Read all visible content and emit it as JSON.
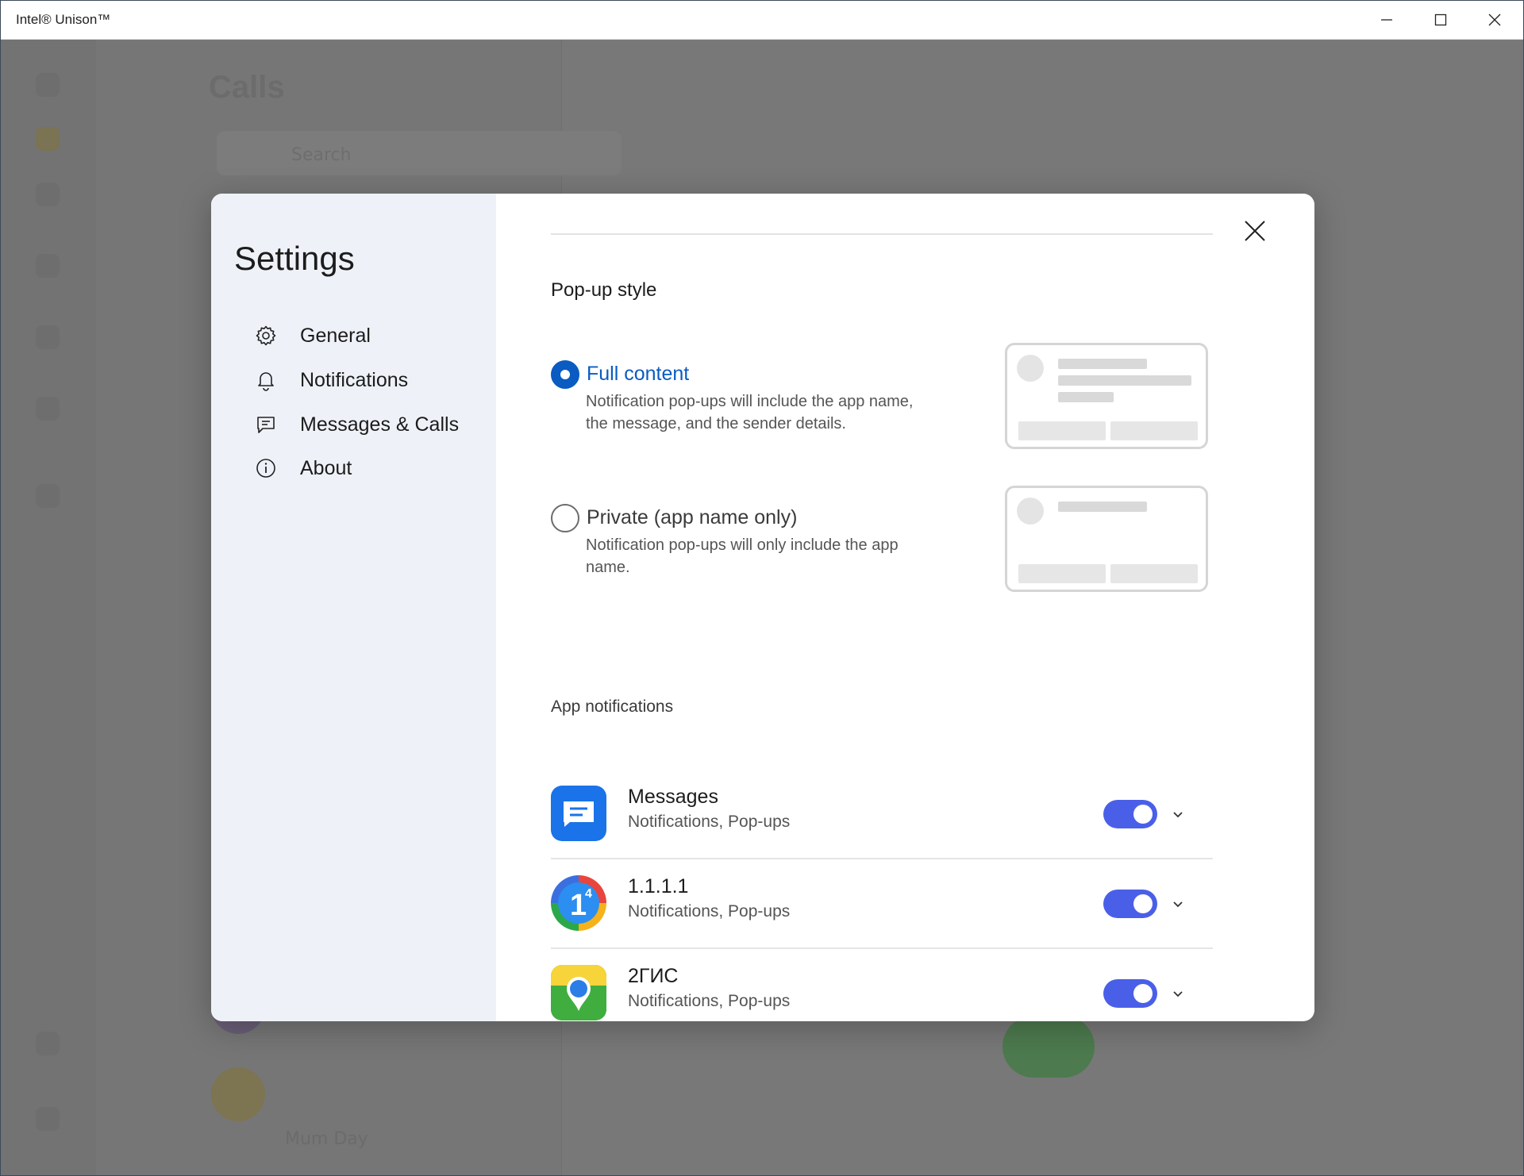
{
  "window": {
    "title": "Intel® Unison™"
  },
  "background": {
    "page_title": "Calls",
    "search_placeholder": "Search",
    "contact_name": "Mum Day"
  },
  "settings": {
    "title": "Settings",
    "nav": [
      {
        "label": "General",
        "icon": "gear-icon"
      },
      {
        "label": "Notifications",
        "icon": "bell-icon"
      },
      {
        "label": "Messages & Calls",
        "icon": "message-icon"
      },
      {
        "label": "About",
        "icon": "info-icon"
      }
    ],
    "popup_style": {
      "heading": "Pop-up style",
      "options": [
        {
          "title": "Full content",
          "desc": "Notification pop-ups will include the app name, the message, and the sender details.",
          "selected": true
        },
        {
          "title": "Private (app name only)",
          "desc": "Notification pop-ups will only include the app name.",
          "selected": false
        }
      ]
    },
    "app_notifications": {
      "heading": "App notifications",
      "apps": [
        {
          "name": "Messages",
          "sub": "Notifications, Pop-ups",
          "enabled": true
        },
        {
          "name": "1.1.1.1",
          "sub": "Notifications, Pop-ups",
          "enabled": true
        },
        {
          "name": "2ГИС",
          "sub": "Notifications, Pop-ups",
          "enabled": true
        }
      ]
    }
  },
  "colors": {
    "accent": "#0a5bc2",
    "toggle": "#4a5fe8",
    "sidebar": "#eef2f8"
  }
}
